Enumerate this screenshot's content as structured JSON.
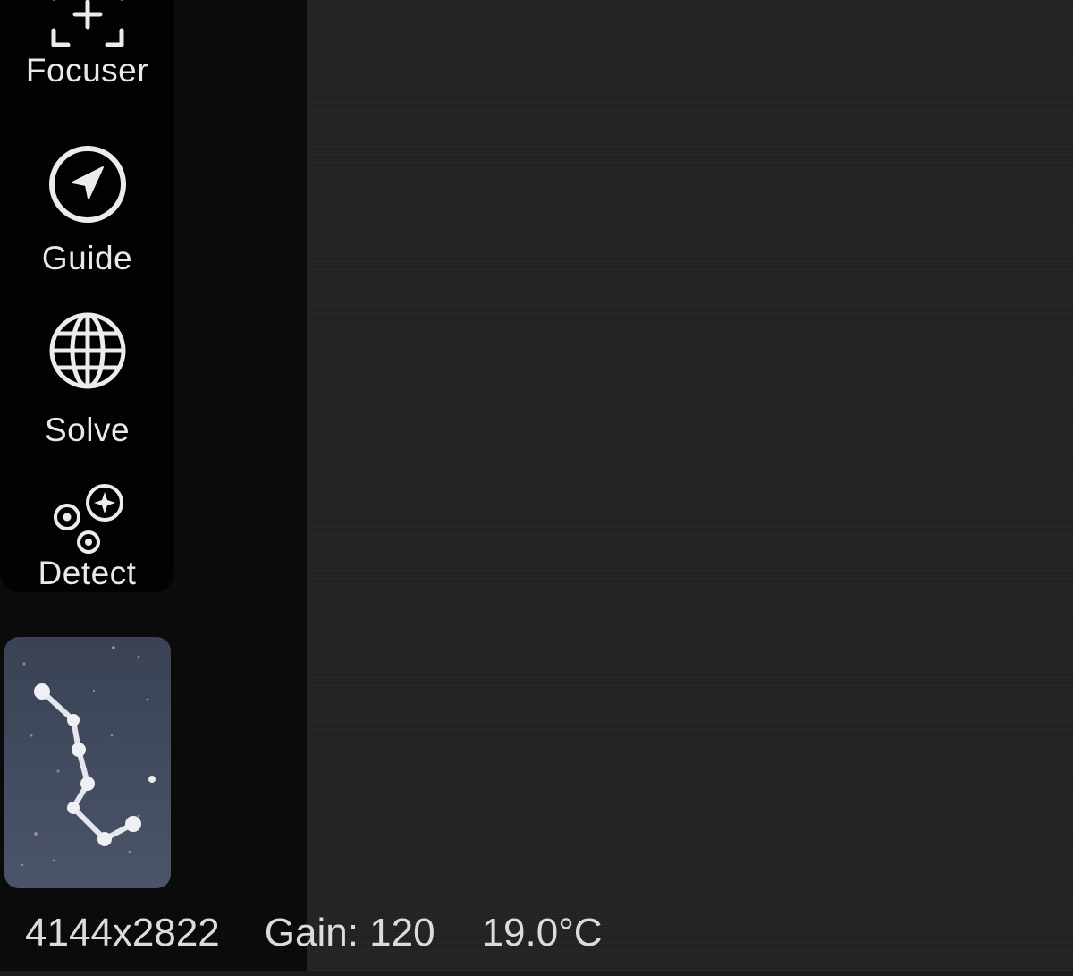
{
  "toolbar": {
    "items": [
      {
        "label": "Focuser",
        "icon": "focus-frame-plus-icon"
      },
      {
        "label": "Guide",
        "icon": "navigation-arrow-circle-icon"
      },
      {
        "label": "Solve",
        "icon": "globe-grid-icon"
      },
      {
        "label": "Detect",
        "icon": "stars-detect-icon"
      }
    ]
  },
  "thumbnail": {
    "icon": "constellation-icon"
  },
  "status": {
    "resolution": "4144x2822",
    "gain": "Gain: 120",
    "temperature": "19.0°C"
  },
  "colors": {
    "toolbar_bg": "#020202",
    "viewer_bg": "#242323",
    "text": "#e9e9e9",
    "thumbnail_bg": "#434c60"
  }
}
